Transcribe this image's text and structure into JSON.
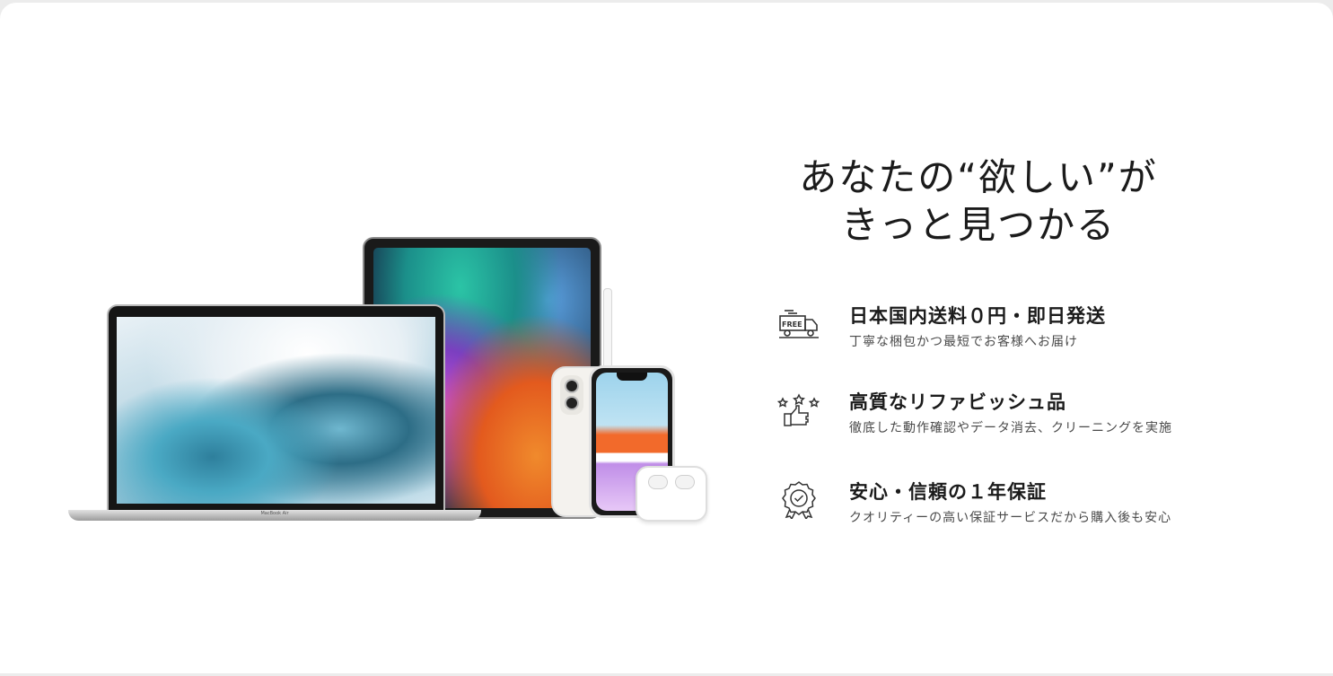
{
  "headline": {
    "line1": "あなたの“欲しい”が",
    "line2": "きっと見つかる"
  },
  "devices": {
    "laptop_label": "MacBook Air"
  },
  "features": [
    {
      "icon": "free-shipping-truck-icon",
      "title": "日本国内送料０円・即日発送",
      "desc": "丁寧な梱包かつ最短でお客様へお届け",
      "icon_text": "FREE"
    },
    {
      "icon": "thumbs-up-stars-icon",
      "title": "高質なリファビッシュ品",
      "desc": "徹底した動作確認やデータ消去、クリーニングを実施"
    },
    {
      "icon": "award-badge-check-icon",
      "title": "安心・信頼の１年保証",
      "desc": "クオリティーの高い保証サービスだから購入後も安心"
    }
  ]
}
